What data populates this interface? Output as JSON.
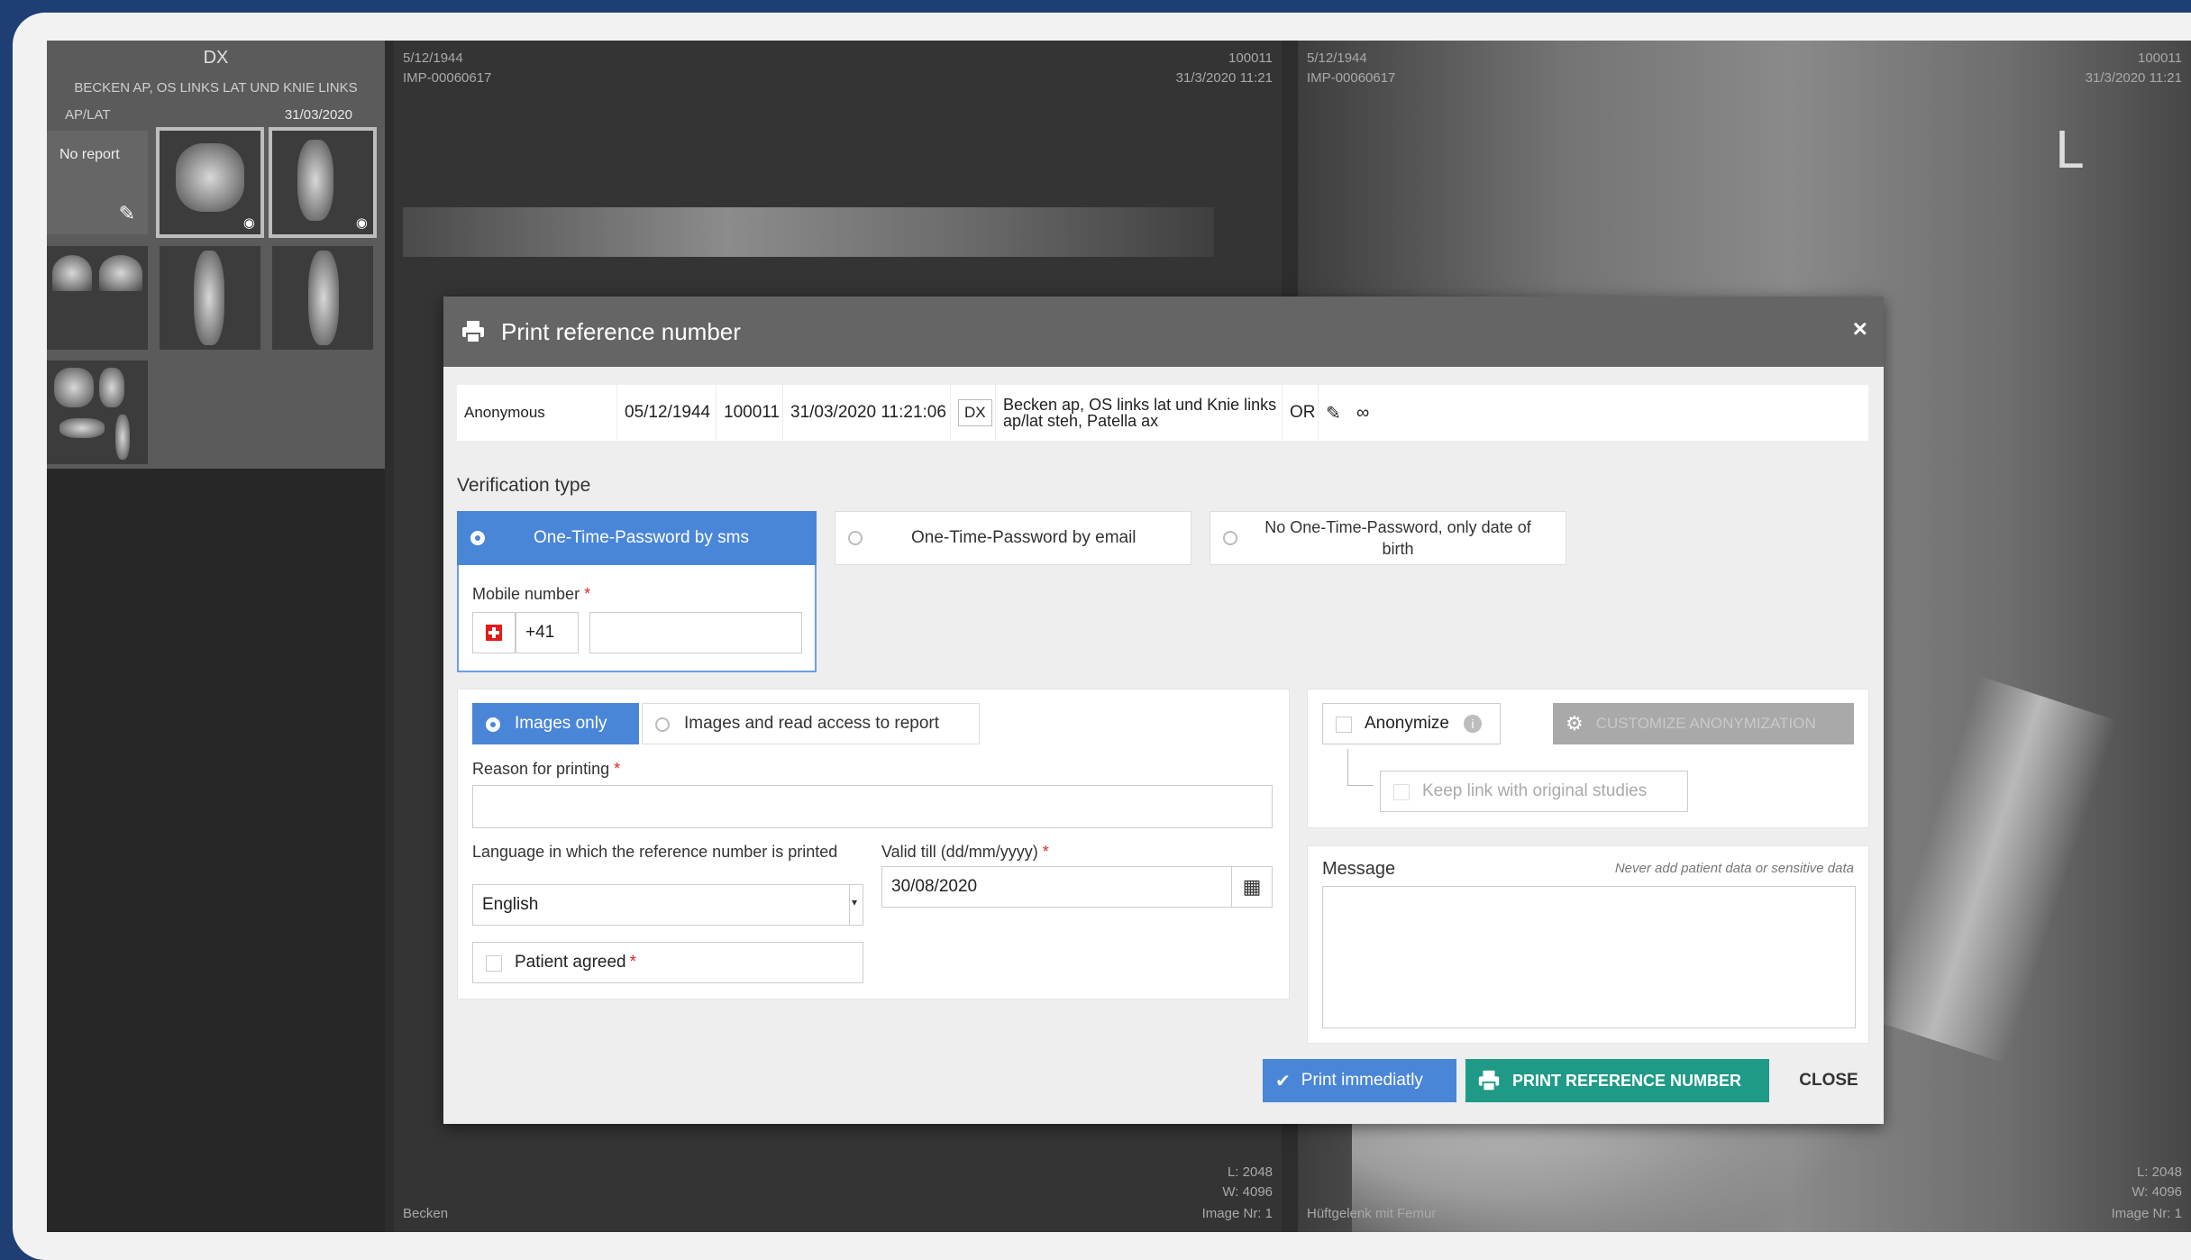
{
  "sidebar": {
    "modality": "DX",
    "study_description": "BECKEN AP, OS LINKS LAT UND KNIE LINKS",
    "study_sub": "AP/LAT",
    "study_date": "31/03/2020",
    "no_report": "No report"
  },
  "viewport_left": {
    "top_left_date": "5/12/1944",
    "top_left_id": "IMP-00060617",
    "top_right_num": "100011",
    "top_right_datetime": "31/3/2020 11:21",
    "bottom_left": "Becken",
    "bottom_right_l": "L: 2048",
    "bottom_right_w": "W: 4096",
    "bottom_right_image": "Image Nr: 1"
  },
  "viewport_right": {
    "top_left_date": "5/12/1944",
    "top_left_id": "IMP-00060617",
    "top_right_num": "100011",
    "top_right_datetime": "31/3/2020 11:21",
    "orientation_marker": "L",
    "bottom_left": "Hüftgelenk mit Femur",
    "bottom_right_l": "L: 2048",
    "bottom_right_w": "W: 4096",
    "bottom_right_image": "Image Nr: 1"
  },
  "modal": {
    "title": "Print reference number",
    "close_symbol": "×",
    "study": {
      "patient": "Anonymous",
      "birthdate": "05/12/1944",
      "patient_id": "100011",
      "datetime": "31/03/2020 11:21:06",
      "modality": "DX",
      "description": "Becken ap, OS links lat und Knie links ap/lat steh, Patella ax",
      "status": "OR"
    },
    "verification": {
      "label": "Verification type",
      "options": [
        "One-Time-Password by sms",
        "One-Time-Password by email",
        "No One-Time-Password, only date of birth"
      ]
    },
    "mobile": {
      "label": "Mobile number",
      "required_mark": "*",
      "prefix": "+41",
      "value": ""
    },
    "access": {
      "options": [
        "Images only",
        "Images and read access to report"
      ]
    },
    "reason": {
      "label": "Reason for printing",
      "required_mark": "*",
      "value": ""
    },
    "language": {
      "label": "Language in which the reference number is printed",
      "value": "English"
    },
    "valid_till": {
      "label": "Valid till (dd/mm/yyyy)",
      "required_mark": "*",
      "value": "30/08/2020"
    },
    "patient_agreed": {
      "label": "Patient agreed",
      "required_mark": "*"
    },
    "anonymize": {
      "label": "Anonymize",
      "info_symbol": "i",
      "customize_label": "CUSTOMIZE ANONYMIZATION",
      "keep_link_label": "Keep link with original studies"
    },
    "message": {
      "label": "Message",
      "hint": "Never add patient data or sensitive data",
      "value": ""
    },
    "buttons": {
      "print_immediately": "Print immediatly",
      "print_reference": "PRINT REFERENCE NUMBER",
      "close": "CLOSE"
    }
  },
  "colors": {
    "accent_blue": "#4a86d8",
    "print_green": "#1f9a86",
    "required_red": "#d9262b",
    "header_grey": "#656565"
  }
}
